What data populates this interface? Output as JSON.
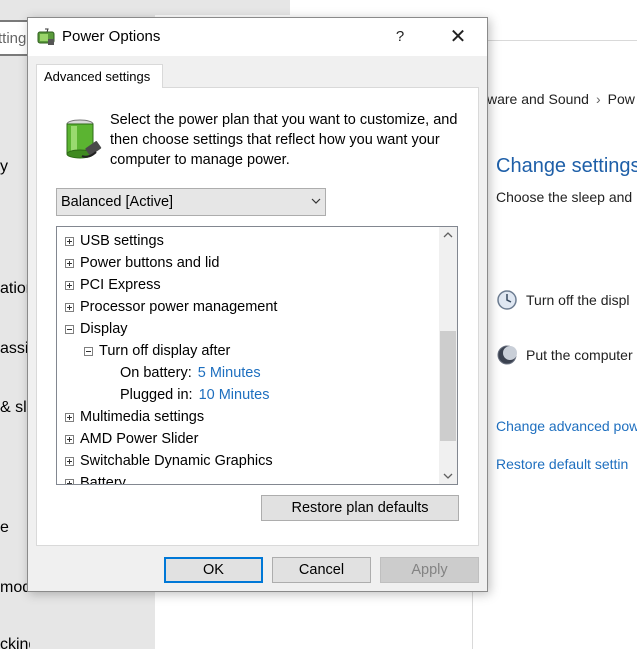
{
  "background": {
    "left_app": {
      "search_partial": "tting",
      "nav_partials": [
        "y",
        "ation",
        "assis",
        "& sl",
        "e",
        "mode",
        "cking"
      ]
    },
    "control_panel": {
      "breadcrumb": [
        "ware and Sound",
        "Pow"
      ],
      "title": "Change settings",
      "subtitle": "Choose the sleep and",
      "rows": [
        {
          "label": "Turn off the displ",
          "icon": "display-timer-icon"
        },
        {
          "label": "Put the computer",
          "icon": "sleep-moon-icon"
        }
      ],
      "links": [
        "Change advanced pow",
        "Restore default settin"
      ]
    }
  },
  "dialog": {
    "title": "Power Options",
    "help_glyph": "?",
    "close_glyph": "✕",
    "tab": "Advanced settings",
    "intro": "Select the power plan that you want to customize, and then choose settings that reflect how you want your computer to manage power.",
    "plan_selected": "Balanced [Active]",
    "tree": {
      "usb": "USB settings",
      "power_buttons": "Power buttons and lid",
      "pci": "PCI Express",
      "processor": "Processor power management",
      "display": "Display",
      "turn_off_display": "Turn off display after",
      "on_battery_label": "On battery:",
      "on_battery_value": "5 Minutes",
      "plugged_label": "Plugged in:",
      "plugged_value": "10 Minutes",
      "multimedia": "Multimedia settings",
      "amd_slider": "AMD Power Slider",
      "switchable": "Switchable Dynamic Graphics",
      "battery": "Battery"
    },
    "buttons": {
      "restore": "Restore plan defaults",
      "ok": "OK",
      "cancel": "Cancel",
      "apply": "Apply"
    },
    "colors": {
      "link": "#1e6fbf",
      "focus_border": "#0078d7",
      "cp_title": "#1e5fa8"
    }
  }
}
